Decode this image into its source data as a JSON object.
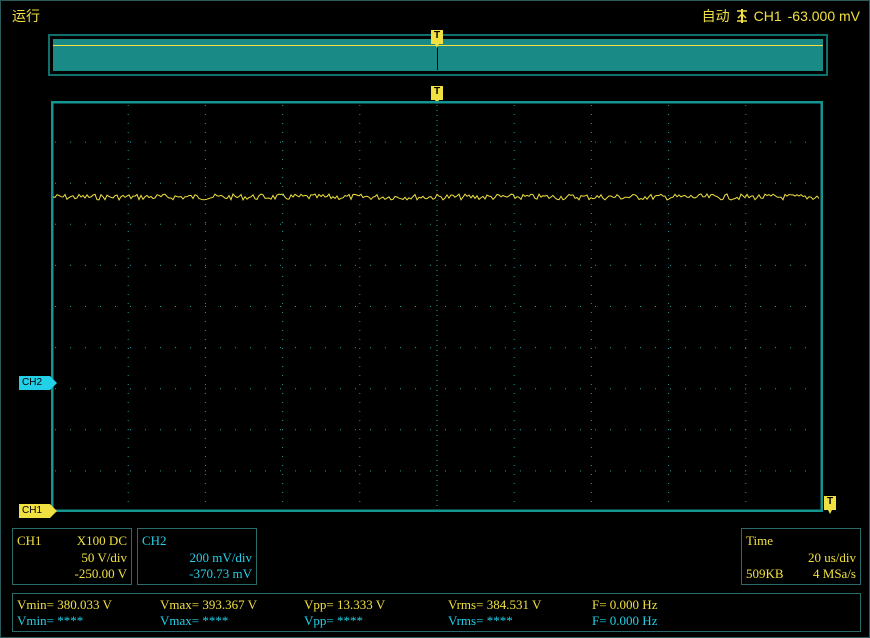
{
  "status": {
    "state": "运行",
    "trigger_mode": "自动",
    "trigger_source": "CH1",
    "trigger_level": "-63.000 mV"
  },
  "trigger_marker_label": "T",
  "badges": {
    "ch2": "CH2",
    "ch1": "CH1"
  },
  "ch1": {
    "name": "CH1",
    "probe_coupling": "X100  DC",
    "scale": "50 V/div",
    "offset": "-250.00 V"
  },
  "ch2": {
    "name": "CH2",
    "scale": "200 mV/div",
    "offset": "-370.73 mV"
  },
  "time": {
    "title": "Time",
    "scale": "20 us/div",
    "memory": "509KB",
    "sample_rate": "4 MSa/s"
  },
  "measurements": {
    "ch1": {
      "vmin": "Vmin= 380.033 V",
      "vmax": "Vmax= 393.367 V",
      "vpp": "Vpp= 13.333 V",
      "vrms": "Vrms= 384.531 V",
      "freq": "F= 0.000 Hz"
    },
    "ch2": {
      "vmin": "Vmin= ****",
      "vmax": "Vmax= ****",
      "vpp": "Vpp= ****",
      "vrms": "Vrms= ****",
      "freq": "F= 0.000 Hz"
    }
  },
  "colors": {
    "ch1": "#f0e040",
    "ch2": "#22d0e8",
    "grid": "#1aa0a0",
    "border": "#139592"
  },
  "icons": {
    "trigger": "trigger-rising-edge-icon"
  }
}
